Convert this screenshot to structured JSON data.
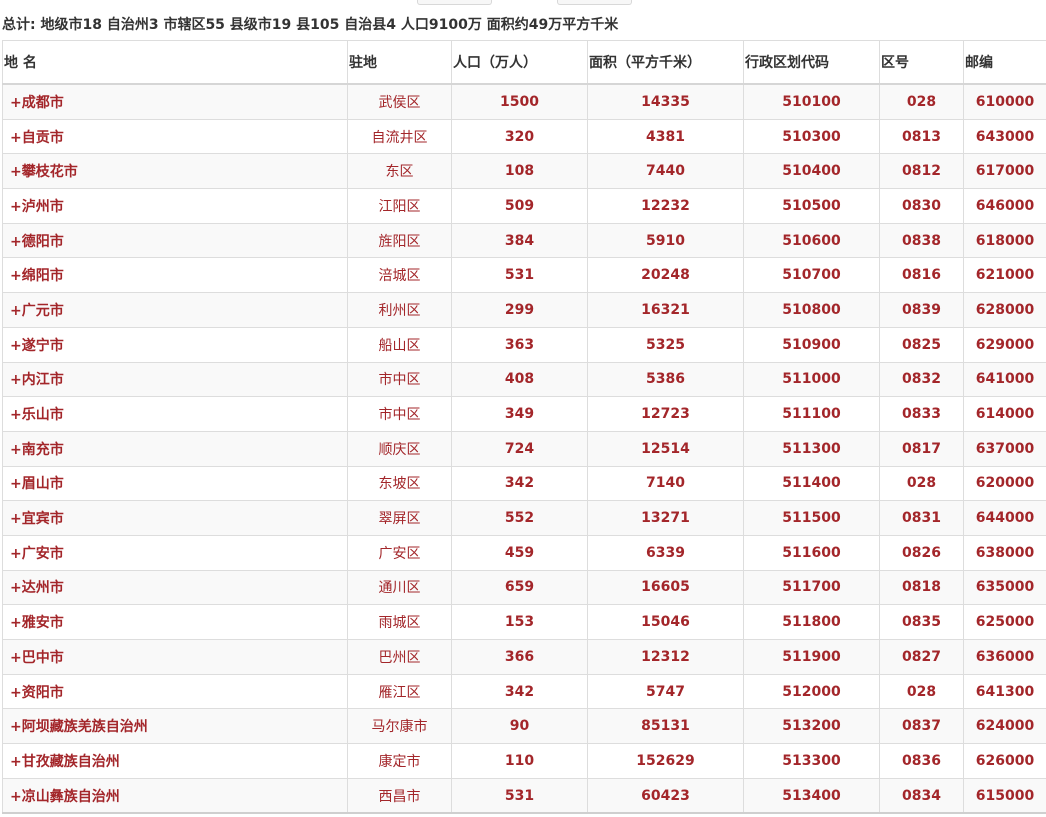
{
  "summary": "总计: 地级市18 自治州3 市辖区55 县级市19 县105 自治县4 人口9100万 面积约49万平方千米",
  "table": {
    "headers": {
      "name": "地 名",
      "seat": "驻地",
      "population": "人口（万人）",
      "area": "面积（平方千米）",
      "code": "行政区划代码",
      "area_code": "区号",
      "postcode": "邮编"
    },
    "rows": [
      {
        "name": "+成都市",
        "seat": "武侯区",
        "population": "1500",
        "area": "14335",
        "code": "510100",
        "area_code": "028",
        "postcode": "610000"
      },
      {
        "name": "+自贡市",
        "seat": "自流井区",
        "population": "320",
        "area": "4381",
        "code": "510300",
        "area_code": "0813",
        "postcode": "643000"
      },
      {
        "name": "+攀枝花市",
        "seat": "东区",
        "population": "108",
        "area": "7440",
        "code": "510400",
        "area_code": "0812",
        "postcode": "617000"
      },
      {
        "name": "+泸州市",
        "seat": "江阳区",
        "population": "509",
        "area": "12232",
        "code": "510500",
        "area_code": "0830",
        "postcode": "646000"
      },
      {
        "name": "+德阳市",
        "seat": "旌阳区",
        "population": "384",
        "area": "5910",
        "code": "510600",
        "area_code": "0838",
        "postcode": "618000"
      },
      {
        "name": "+绵阳市",
        "seat": "涪城区",
        "population": "531",
        "area": "20248",
        "code": "510700",
        "area_code": "0816",
        "postcode": "621000"
      },
      {
        "name": "+广元市",
        "seat": "利州区",
        "population": "299",
        "area": "16321",
        "code": "510800",
        "area_code": "0839",
        "postcode": "628000"
      },
      {
        "name": "+遂宁市",
        "seat": "船山区",
        "population": "363",
        "area": "5325",
        "code": "510900",
        "area_code": "0825",
        "postcode": "629000"
      },
      {
        "name": "+内江市",
        "seat": "市中区",
        "population": "408",
        "area": "5386",
        "code": "511000",
        "area_code": "0832",
        "postcode": "641000"
      },
      {
        "name": "+乐山市",
        "seat": "市中区",
        "population": "349",
        "area": "12723",
        "code": "511100",
        "area_code": "0833",
        "postcode": "614000"
      },
      {
        "name": "+南充市",
        "seat": "顺庆区",
        "population": "724",
        "area": "12514",
        "code": "511300",
        "area_code": "0817",
        "postcode": "637000"
      },
      {
        "name": "+眉山市",
        "seat": "东坡区",
        "population": "342",
        "area": "7140",
        "code": "511400",
        "area_code": "028",
        "postcode": "620000"
      },
      {
        "name": "+宜宾市",
        "seat": "翠屏区",
        "population": "552",
        "area": "13271",
        "code": "511500",
        "area_code": "0831",
        "postcode": "644000"
      },
      {
        "name": "+广安市",
        "seat": "广安区",
        "population": "459",
        "area": "6339",
        "code": "511600",
        "area_code": "0826",
        "postcode": "638000"
      },
      {
        "name": "+达州市",
        "seat": "通川区",
        "population": "659",
        "area": "16605",
        "code": "511700",
        "area_code": "0818",
        "postcode": "635000"
      },
      {
        "name": "+雅安市",
        "seat": "雨城区",
        "population": "153",
        "area": "15046",
        "code": "511800",
        "area_code": "0835",
        "postcode": "625000"
      },
      {
        "name": "+巴中市",
        "seat": "巴州区",
        "population": "366",
        "area": "12312",
        "code": "511900",
        "area_code": "0827",
        "postcode": "636000"
      },
      {
        "name": "+资阳市",
        "seat": "雁江区",
        "population": "342",
        "area": "5747",
        "code": "512000",
        "area_code": "028",
        "postcode": "641300"
      },
      {
        "name": "+阿坝藏族羌族自治州",
        "seat": "马尔康市",
        "population": "90",
        "area": "85131",
        "code": "513200",
        "area_code": "0837",
        "postcode": "624000"
      },
      {
        "name": "+甘孜藏族自治州",
        "seat": "康定市",
        "population": "110",
        "area": "152629",
        "code": "513300",
        "area_code": "0836",
        "postcode": "626000"
      },
      {
        "name": "+凉山彝族自治州",
        "seat": "西昌市",
        "population": "531",
        "area": "60423",
        "code": "513400",
        "area_code": "0834",
        "postcode": "615000"
      }
    ]
  }
}
